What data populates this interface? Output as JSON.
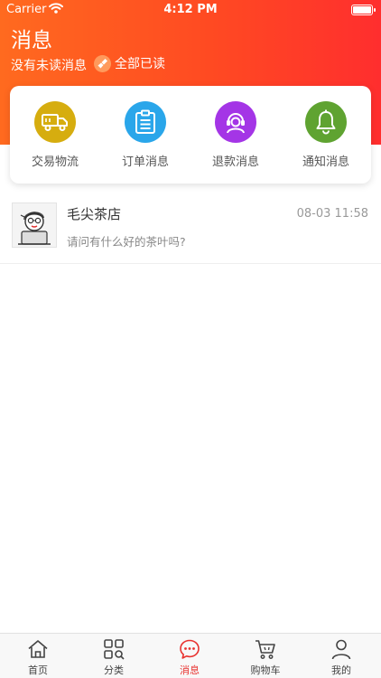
{
  "status_bar": {
    "carrier": "Carrier",
    "time": "4:12 PM"
  },
  "header": {
    "title": "消息",
    "unread_text": "没有未读消息",
    "mark_all_read": "全部已读"
  },
  "categories": [
    {
      "label": "交易物流",
      "icon": "truck-icon",
      "color": "#d6ad0f"
    },
    {
      "label": "订单消息",
      "icon": "clipboard-icon",
      "color": "#2aa6ea"
    },
    {
      "label": "退款消息",
      "icon": "customer-service-icon",
      "color": "#a435e6"
    },
    {
      "label": "通知消息",
      "icon": "bell-icon",
      "color": "#5fa331"
    }
  ],
  "messages": [
    {
      "name": "毛尖茶店",
      "time": "08-03 11:58",
      "preview": "请问有什么好的茶叶吗?"
    }
  ],
  "tabbar": {
    "active": "消息",
    "accent": "#e8322f",
    "items": [
      {
        "label": "首页",
        "icon": "home-icon"
      },
      {
        "label": "分类",
        "icon": "category-icon"
      },
      {
        "label": "消息",
        "icon": "message-icon"
      },
      {
        "label": "购物车",
        "icon": "cart-icon"
      },
      {
        "label": "我的",
        "icon": "profile-icon"
      }
    ]
  }
}
